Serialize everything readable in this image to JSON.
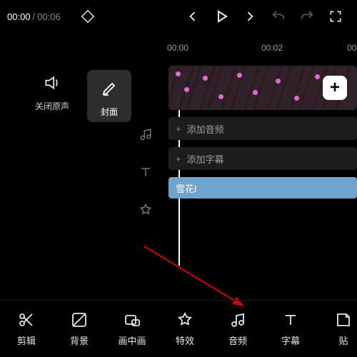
{
  "playback": {
    "current": "00:00",
    "total": "00:06"
  },
  "timeline": {
    "ticks": [
      "00:00",
      "00:02",
      "00:0"
    ]
  },
  "left_tools": {
    "mute": {
      "label": "关闭原声"
    },
    "cover": {
      "label": "封面"
    }
  },
  "side_icons": [
    "music-icon",
    "text-icon",
    "effects-icon"
  ],
  "tracks": {
    "add_audio": "添加音频",
    "add_subtitle": "添加字幕",
    "effect_clip": "雪花I"
  },
  "bottom_tools": {
    "edit": {
      "label": "剪辑"
    },
    "bg": {
      "label": "背景"
    },
    "pip": {
      "label": "画中画"
    },
    "fx": {
      "label": "特效"
    },
    "audio": {
      "label": "音频"
    },
    "sub": {
      "label": "字幕"
    },
    "sticker": {
      "label": "贴"
    }
  }
}
